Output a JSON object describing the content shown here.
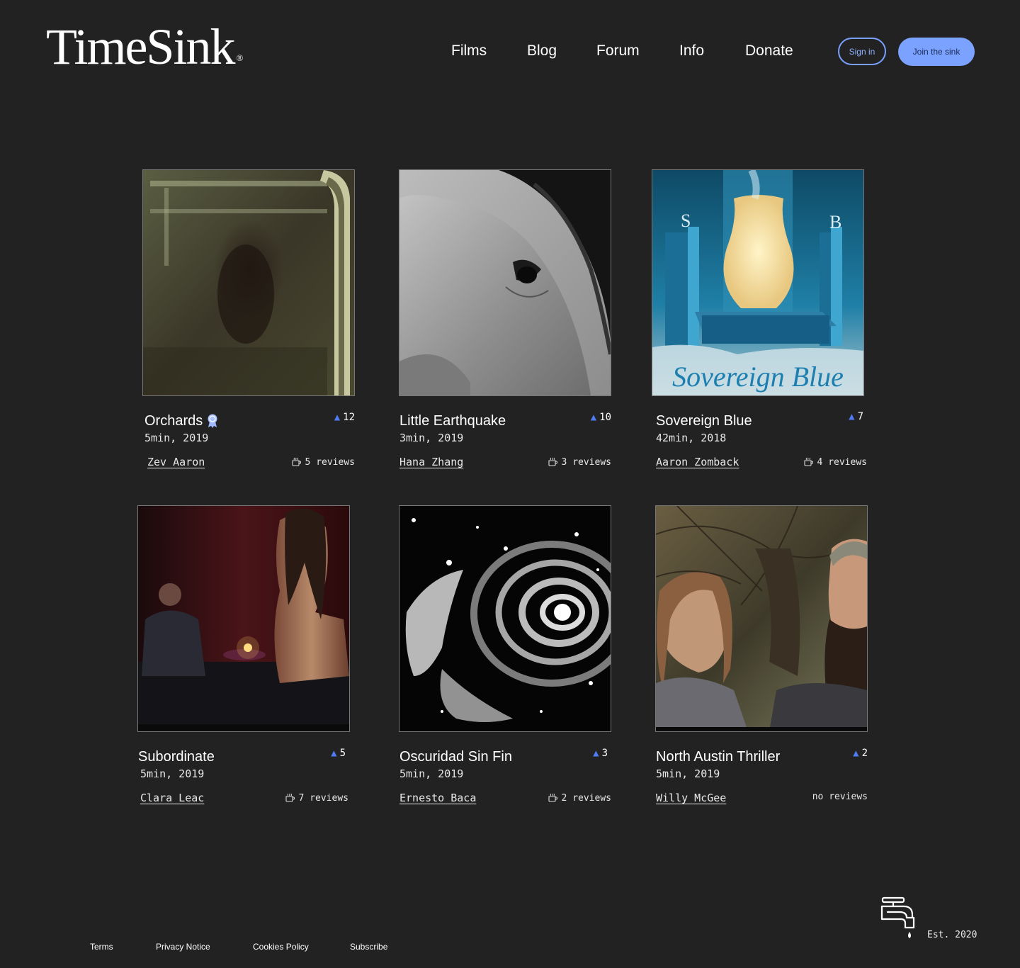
{
  "header": {
    "logo": "TimeSink",
    "logo_mark": "®",
    "nav": [
      {
        "label": "Films"
      },
      {
        "label": "Blog"
      },
      {
        "label": "Forum"
      },
      {
        "label": "Info"
      },
      {
        "label": "Donate"
      }
    ],
    "sign_in_label": "Sign in",
    "join_label": "Join the sink"
  },
  "films": [
    {
      "title": "Orchards",
      "award": true,
      "votes": "12",
      "meta": "5min, 2019",
      "director": "Zev Aaron",
      "reviews": "5 reviews",
      "has_reviews": true
    },
    {
      "title": "Little Earthquake",
      "award": false,
      "votes": "10",
      "meta": "3min, 2019",
      "director": "Hana Zhang",
      "reviews": "3 reviews",
      "has_reviews": true
    },
    {
      "title": "Sovereign Blue",
      "award": false,
      "votes": "7",
      "meta": "42min, 2018",
      "director": "Aaron Zomback",
      "reviews": "4 reviews",
      "has_reviews": true,
      "poster_text": "Sovereign Blue",
      "poster_letters": [
        "S",
        "B"
      ]
    },
    {
      "title": "Subordinate",
      "award": false,
      "votes": "5",
      "meta": "5min, 2019",
      "director": "Clara Leac",
      "reviews": "7 reviews",
      "has_reviews": true
    },
    {
      "title": "Oscuridad Sin Fin",
      "award": false,
      "votes": "3",
      "meta": "5min, 2019",
      "director": "Ernesto Baca",
      "reviews": "2 reviews",
      "has_reviews": true
    },
    {
      "title": "North Austin Thriller",
      "award": false,
      "votes": "2",
      "meta": "5min, 2019",
      "director": "Willy McGee",
      "reviews": "no reviews",
      "has_reviews": false
    }
  ],
  "footer": {
    "links": [
      {
        "label": "Terms"
      },
      {
        "label": "Privacy Notice"
      },
      {
        "label": "Cookies Policy"
      },
      {
        "label": "Subscribe"
      }
    ],
    "est": "Est. 2020"
  },
  "icons": {
    "vote": "triangle-up-icon",
    "award": "award-ribbon-icon",
    "reviews": "coffee-cup-icon",
    "footer_mark": "faucet-icon"
  },
  "colors": {
    "background": "#222222",
    "accent": "#7ba2ff",
    "vote": "#4f7cf5"
  }
}
